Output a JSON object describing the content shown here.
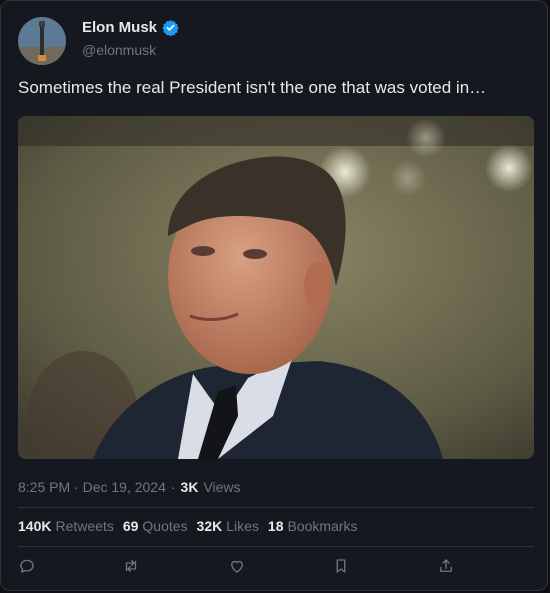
{
  "author": {
    "display_name": "Elon Musk",
    "handle": "@elonmusk",
    "verified": true,
    "verified_color": "#1d9bf0"
  },
  "tweet": {
    "text": "Sometimes the real President isn't the one that was voted in…",
    "timestamp": "8:25 PM · Dec 19, 2024",
    "separator": "·",
    "views_count": "3K",
    "views_label": "Views"
  },
  "stats": {
    "retweets_count": "140K",
    "retweets_label": "Retweets",
    "quotes_count": "69",
    "quotes_label": "Quotes",
    "likes_count": "32K",
    "likes_label": "Likes",
    "bookmarks_count": "18",
    "bookmarks_label": "Bookmarks"
  },
  "actions": [
    "reply-icon",
    "retweet-icon",
    "like-icon",
    "bookmark-icon",
    "share-icon"
  ],
  "colors": {
    "card_bg": "#15191f",
    "text_primary": "#e7e9ea",
    "text_secondary": "#71767b"
  }
}
